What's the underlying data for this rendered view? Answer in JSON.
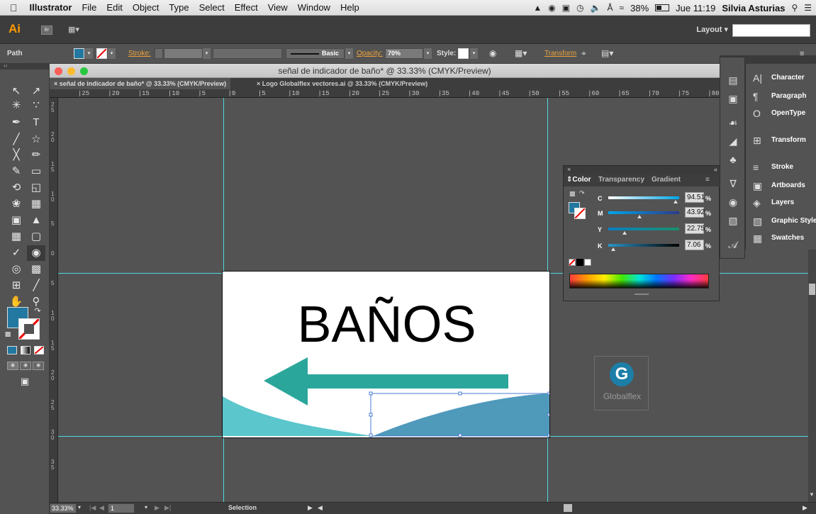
{
  "menubar": {
    "apple": "",
    "items": [
      "Illustrator",
      "File",
      "Edit",
      "Object",
      "Type",
      "Select",
      "Effect",
      "View",
      "Window",
      "Help"
    ],
    "battery": "38%",
    "clock": "Jue 11:19",
    "user": "Silvia Asturias"
  },
  "appbar": {
    "logo": "Ai",
    "bridge": "Br",
    "workspace": "Layout",
    "search_placeholder": ""
  },
  "control": {
    "selection_type": "Path",
    "fill_color": "#2278a0",
    "stroke_label": "Stroke:",
    "brush_label": "Basic",
    "opacity_label": "Opacity:",
    "opacity_value": "70%",
    "style_label": "Style:",
    "transform_label": "Transform"
  },
  "document": {
    "window_title": "señal de indicador de baño* @ 33.33% (CMYK/Preview)",
    "tabs": [
      {
        "label": "señal de indicador de baño* @ 33.33% (CMYK/Preview)",
        "active": true
      },
      {
        "label": "Logo Globalflex vectores.ai @ 33.33% (CMYK/Preview)",
        "active": false
      }
    ],
    "ruler_h": [
      "25",
      "20",
      "15",
      "10",
      "5",
      "0",
      "5",
      "10",
      "15",
      "20",
      "25",
      "30",
      "35",
      "40",
      "45",
      "50",
      "55",
      "60",
      "65",
      "70",
      "75",
      "80"
    ],
    "ruler_v": [
      "2\n5",
      "2\n0",
      "1\n5",
      "1\n0",
      "5",
      "0",
      "5",
      "1\n0",
      "1\n5",
      "2\n0",
      "2\n5",
      "3\n0",
      "3\n5"
    ]
  },
  "artboard": {
    "heading": "BAÑOS",
    "arrow_color": "#2ba69b",
    "wave_left_color": "#5bc6cc",
    "wave_right_color": "#4f99bb"
  },
  "logo_on_canvas": {
    "text": "Globalflex",
    "letter": "G",
    "color": "#1d7ea8"
  },
  "color_panel": {
    "tabs": [
      "Color",
      "Transparency",
      "Gradient"
    ],
    "channels": [
      {
        "label": "C",
        "value": "94.51",
        "fraction": 0.945
      },
      {
        "label": "M",
        "value": "43.92",
        "fraction": 0.439
      },
      {
        "label": "Y",
        "value": "22.75",
        "fraction": 0.2275
      },
      {
        "label": "K",
        "value": "7.06",
        "fraction": 0.0706
      }
    ],
    "percent": "%",
    "fill_color": "#2278a0"
  },
  "dock": {
    "items": [
      "Character",
      "Paragraph",
      "OpenType",
      "Transform",
      "Stroke",
      "Artboards",
      "Layers",
      "Graphic Styles",
      "Swatches"
    ]
  },
  "status": {
    "zoom": "33.33%",
    "page": "1",
    "tool": "Selection"
  },
  "tools_fill_color": "#2278a0"
}
